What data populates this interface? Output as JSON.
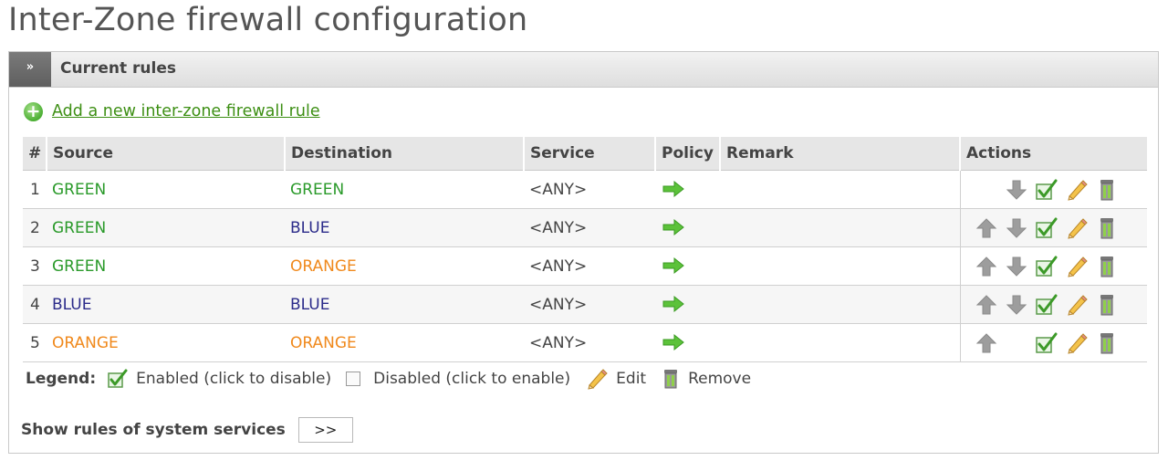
{
  "page": {
    "title": "Inter-Zone firewall configuration"
  },
  "panel": {
    "toggle_label": "»",
    "title": "Current rules"
  },
  "add_rule": {
    "label": "Add a new inter-zone firewall rule"
  },
  "table": {
    "columns": [
      "#",
      "Source",
      "Destination",
      "Service",
      "Policy",
      "Remark",
      "Actions"
    ],
    "rows": [
      {
        "num": "1",
        "source": "GREEN",
        "source_color": "#2a9a2a",
        "destination": "GREEN",
        "destination_color": "#2a9a2a",
        "service": "<ANY>",
        "remark": "",
        "can_move_up": false,
        "can_move_down": true
      },
      {
        "num": "2",
        "source": "GREEN",
        "source_color": "#2a9a2a",
        "destination": "BLUE",
        "destination_color": "#2b2b8a",
        "service": "<ANY>",
        "remark": "",
        "can_move_up": true,
        "can_move_down": true
      },
      {
        "num": "3",
        "source": "GREEN",
        "source_color": "#2a9a2a",
        "destination": "ORANGE",
        "destination_color": "#f0891c",
        "service": "<ANY>",
        "remark": "",
        "can_move_up": true,
        "can_move_down": true
      },
      {
        "num": "4",
        "source": "BLUE",
        "source_color": "#2b2b8a",
        "destination": "BLUE",
        "destination_color": "#2b2b8a",
        "service": "<ANY>",
        "remark": "",
        "can_move_up": true,
        "can_move_down": true
      },
      {
        "num": "5",
        "source": "ORANGE",
        "source_color": "#f0891c",
        "destination": "ORANGE",
        "destination_color": "#f0891c",
        "service": "<ANY>",
        "remark": "",
        "can_move_up": true,
        "can_move_down": false
      }
    ]
  },
  "legend": {
    "label": "Legend:",
    "enabled": "Enabled (click to disable)",
    "disabled": "Disabled (click to enable)",
    "edit": "Edit",
    "remove": "Remove"
  },
  "system_services": {
    "label": "Show rules of system services",
    "button": ">>"
  },
  "icons": {
    "policy": "green-right-arrow-icon",
    "move_up": "arrow-up-icon",
    "move_down": "arrow-down-icon",
    "enabled": "checkbox-checked-icon",
    "edit": "pencil-icon",
    "remove": "trash-can-icon",
    "add": "plus-circle-icon"
  },
  "colors": {
    "green_zone": "#2a9a2a",
    "blue_zone": "#2b2b8a",
    "orange_zone": "#f0891c",
    "link": "#3d8f14"
  }
}
